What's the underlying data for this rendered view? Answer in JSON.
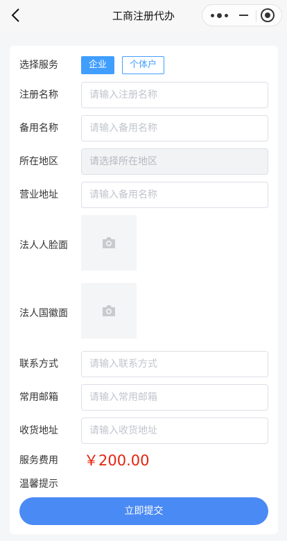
{
  "navbar": {
    "title": "工商注册代办"
  },
  "form": {
    "service_type": {
      "label": "选择服务",
      "options": [
        "企业",
        "个体户"
      ],
      "selected": "企业"
    },
    "register_name": {
      "label": "注册名称",
      "placeholder": "请输入注册名称"
    },
    "backup_name": {
      "label": "备用名称",
      "placeholder": "请输入备用名称"
    },
    "region": {
      "label": "所在地区",
      "placeholder": "请选择所在地区"
    },
    "business_address": {
      "label": "营业地址",
      "placeholder": "请输入备用名称"
    },
    "legal_face": {
      "label": "法人人脸面"
    },
    "legal_emblem": {
      "label": "法人国徽面"
    },
    "contact": {
      "label": "联系方式",
      "placeholder": "请输入联系方式"
    },
    "email": {
      "label": "常用邮箱",
      "placeholder": "请输入常用邮箱"
    },
    "shipping_address": {
      "label": "收货地址",
      "placeholder": "请输入收货地址"
    },
    "fee": {
      "label": "服务费用",
      "value": "￥200.00"
    },
    "tips": {
      "label": "温馨提示"
    },
    "submit_label": "立即提交"
  },
  "colors": {
    "accent": "#409eff",
    "price": "#e4230f",
    "submit": "#4a8af4"
  },
  "icons": {
    "back": "chevron-left-icon",
    "more": "more-dots-icon",
    "minimize": "minus-icon",
    "close": "target-circle-icon",
    "upload": "camera-icon"
  }
}
